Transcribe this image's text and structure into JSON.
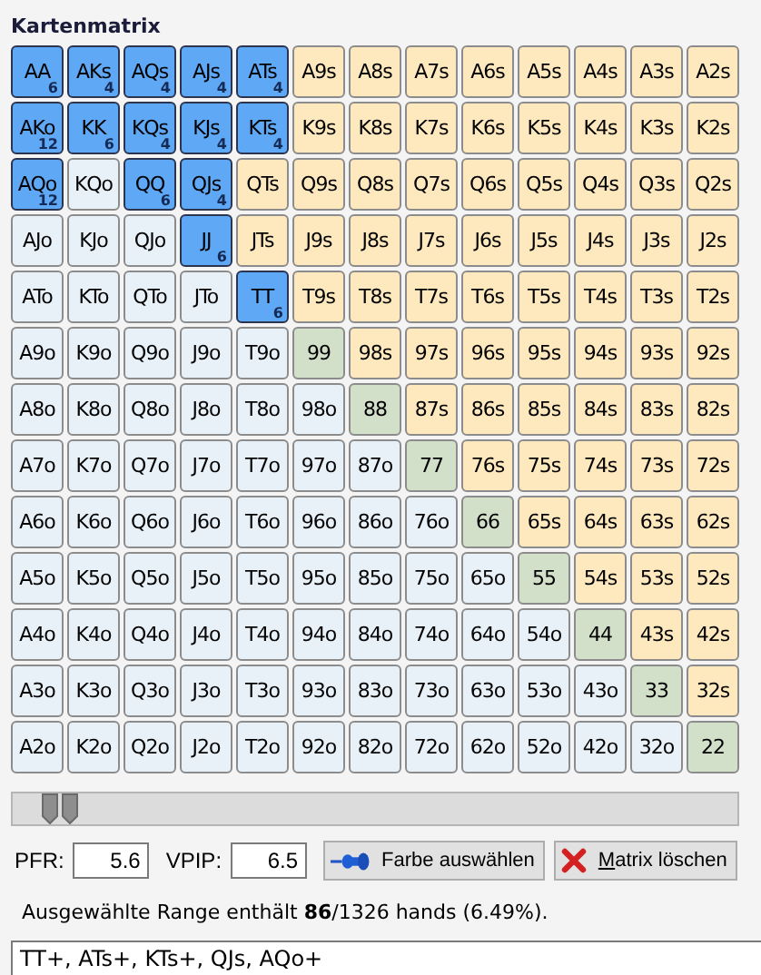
{
  "matrix": {
    "title": "Kartenmatrix",
    "rows": [
      [
        {
          "label": "AA",
          "kind": "pair",
          "selected": true,
          "count": "6"
        },
        {
          "label": "AKs",
          "kind": "suited",
          "selected": true,
          "count": "4"
        },
        {
          "label": "AQs",
          "kind": "suited",
          "selected": true,
          "count": "4"
        },
        {
          "label": "AJs",
          "kind": "suited",
          "selected": true,
          "count": "4"
        },
        {
          "label": "ATs",
          "kind": "suited",
          "selected": true,
          "count": "4"
        },
        {
          "label": "A9s",
          "kind": "suited",
          "selected": false
        },
        {
          "label": "A8s",
          "kind": "suited",
          "selected": false
        },
        {
          "label": "A7s",
          "kind": "suited",
          "selected": false
        },
        {
          "label": "A6s",
          "kind": "suited",
          "selected": false
        },
        {
          "label": "A5s",
          "kind": "suited",
          "selected": false
        },
        {
          "label": "A4s",
          "kind": "suited",
          "selected": false
        },
        {
          "label": "A3s",
          "kind": "suited",
          "selected": false
        },
        {
          "label": "A2s",
          "kind": "suited",
          "selected": false
        }
      ],
      [
        {
          "label": "AKo",
          "kind": "offsuit",
          "selected": true,
          "count": "12"
        },
        {
          "label": "KK",
          "kind": "pair",
          "selected": true,
          "count": "6"
        },
        {
          "label": "KQs",
          "kind": "suited",
          "selected": true,
          "count": "4"
        },
        {
          "label": "KJs",
          "kind": "suited",
          "selected": true,
          "count": "4"
        },
        {
          "label": "KTs",
          "kind": "suited",
          "selected": true,
          "count": "4"
        },
        {
          "label": "K9s",
          "kind": "suited",
          "selected": false
        },
        {
          "label": "K8s",
          "kind": "suited",
          "selected": false
        },
        {
          "label": "K7s",
          "kind": "suited",
          "selected": false
        },
        {
          "label": "K6s",
          "kind": "suited",
          "selected": false
        },
        {
          "label": "K5s",
          "kind": "suited",
          "selected": false
        },
        {
          "label": "K4s",
          "kind": "suited",
          "selected": false
        },
        {
          "label": "K3s",
          "kind": "suited",
          "selected": false
        },
        {
          "label": "K2s",
          "kind": "suited",
          "selected": false
        }
      ],
      [
        {
          "label": "AQo",
          "kind": "offsuit",
          "selected": true,
          "count": "12"
        },
        {
          "label": "KQo",
          "kind": "offsuit",
          "selected": false
        },
        {
          "label": "QQ",
          "kind": "pair",
          "selected": true,
          "count": "6"
        },
        {
          "label": "QJs",
          "kind": "suited",
          "selected": true,
          "count": "4"
        },
        {
          "label": "QTs",
          "kind": "suited",
          "selected": false
        },
        {
          "label": "Q9s",
          "kind": "suited",
          "selected": false
        },
        {
          "label": "Q8s",
          "kind": "suited",
          "selected": false
        },
        {
          "label": "Q7s",
          "kind": "suited",
          "selected": false
        },
        {
          "label": "Q6s",
          "kind": "suited",
          "selected": false
        },
        {
          "label": "Q5s",
          "kind": "suited",
          "selected": false
        },
        {
          "label": "Q4s",
          "kind": "suited",
          "selected": false
        },
        {
          "label": "Q3s",
          "kind": "suited",
          "selected": false
        },
        {
          "label": "Q2s",
          "kind": "suited",
          "selected": false
        }
      ],
      [
        {
          "label": "AJo",
          "kind": "offsuit",
          "selected": false
        },
        {
          "label": "KJo",
          "kind": "offsuit",
          "selected": false
        },
        {
          "label": "QJo",
          "kind": "offsuit",
          "selected": false
        },
        {
          "label": "JJ",
          "kind": "pair",
          "selected": true,
          "count": "6"
        },
        {
          "label": "JTs",
          "kind": "suited",
          "selected": false
        },
        {
          "label": "J9s",
          "kind": "suited",
          "selected": false
        },
        {
          "label": "J8s",
          "kind": "suited",
          "selected": false
        },
        {
          "label": "J7s",
          "kind": "suited",
          "selected": false
        },
        {
          "label": "J6s",
          "kind": "suited",
          "selected": false
        },
        {
          "label": "J5s",
          "kind": "suited",
          "selected": false
        },
        {
          "label": "J4s",
          "kind": "suited",
          "selected": false
        },
        {
          "label": "J3s",
          "kind": "suited",
          "selected": false
        },
        {
          "label": "J2s",
          "kind": "suited",
          "selected": false
        }
      ],
      [
        {
          "label": "ATo",
          "kind": "offsuit",
          "selected": false
        },
        {
          "label": "KTo",
          "kind": "offsuit",
          "selected": false
        },
        {
          "label": "QTo",
          "kind": "offsuit",
          "selected": false
        },
        {
          "label": "JTo",
          "kind": "offsuit",
          "selected": false
        },
        {
          "label": "TT",
          "kind": "pair",
          "selected": true,
          "count": "6"
        },
        {
          "label": "T9s",
          "kind": "suited",
          "selected": false
        },
        {
          "label": "T8s",
          "kind": "suited",
          "selected": false
        },
        {
          "label": "T7s",
          "kind": "suited",
          "selected": false
        },
        {
          "label": "T6s",
          "kind": "suited",
          "selected": false
        },
        {
          "label": "T5s",
          "kind": "suited",
          "selected": false
        },
        {
          "label": "T4s",
          "kind": "suited",
          "selected": false
        },
        {
          "label": "T3s",
          "kind": "suited",
          "selected": false
        },
        {
          "label": "T2s",
          "kind": "suited",
          "selected": false
        }
      ],
      [
        {
          "label": "A9o",
          "kind": "offsuit",
          "selected": false
        },
        {
          "label": "K9o",
          "kind": "offsuit",
          "selected": false
        },
        {
          "label": "Q9o",
          "kind": "offsuit",
          "selected": false
        },
        {
          "label": "J9o",
          "kind": "offsuit",
          "selected": false
        },
        {
          "label": "T9o",
          "kind": "offsuit",
          "selected": false
        },
        {
          "label": "99",
          "kind": "pair",
          "selected": false
        },
        {
          "label": "98s",
          "kind": "suited",
          "selected": false
        },
        {
          "label": "97s",
          "kind": "suited",
          "selected": false
        },
        {
          "label": "96s",
          "kind": "suited",
          "selected": false
        },
        {
          "label": "95s",
          "kind": "suited",
          "selected": false
        },
        {
          "label": "94s",
          "kind": "suited",
          "selected": false
        },
        {
          "label": "93s",
          "kind": "suited",
          "selected": false
        },
        {
          "label": "92s",
          "kind": "suited",
          "selected": false
        }
      ],
      [
        {
          "label": "A8o",
          "kind": "offsuit",
          "selected": false
        },
        {
          "label": "K8o",
          "kind": "offsuit",
          "selected": false
        },
        {
          "label": "Q8o",
          "kind": "offsuit",
          "selected": false
        },
        {
          "label": "J8o",
          "kind": "offsuit",
          "selected": false
        },
        {
          "label": "T8o",
          "kind": "offsuit",
          "selected": false
        },
        {
          "label": "98o",
          "kind": "offsuit",
          "selected": false
        },
        {
          "label": "88",
          "kind": "pair",
          "selected": false
        },
        {
          "label": "87s",
          "kind": "suited",
          "selected": false
        },
        {
          "label": "86s",
          "kind": "suited",
          "selected": false
        },
        {
          "label": "85s",
          "kind": "suited",
          "selected": false
        },
        {
          "label": "84s",
          "kind": "suited",
          "selected": false
        },
        {
          "label": "83s",
          "kind": "suited",
          "selected": false
        },
        {
          "label": "82s",
          "kind": "suited",
          "selected": false
        }
      ],
      [
        {
          "label": "A7o",
          "kind": "offsuit",
          "selected": false
        },
        {
          "label": "K7o",
          "kind": "offsuit",
          "selected": false
        },
        {
          "label": "Q7o",
          "kind": "offsuit",
          "selected": false
        },
        {
          "label": "J7o",
          "kind": "offsuit",
          "selected": false
        },
        {
          "label": "T7o",
          "kind": "offsuit",
          "selected": false
        },
        {
          "label": "97o",
          "kind": "offsuit",
          "selected": false
        },
        {
          "label": "87o",
          "kind": "offsuit",
          "selected": false
        },
        {
          "label": "77",
          "kind": "pair",
          "selected": false
        },
        {
          "label": "76s",
          "kind": "suited",
          "selected": false
        },
        {
          "label": "75s",
          "kind": "suited",
          "selected": false
        },
        {
          "label": "74s",
          "kind": "suited",
          "selected": false
        },
        {
          "label": "73s",
          "kind": "suited",
          "selected": false
        },
        {
          "label": "72s",
          "kind": "suited",
          "selected": false
        }
      ],
      [
        {
          "label": "A6o",
          "kind": "offsuit",
          "selected": false
        },
        {
          "label": "K6o",
          "kind": "offsuit",
          "selected": false
        },
        {
          "label": "Q6o",
          "kind": "offsuit",
          "selected": false
        },
        {
          "label": "J6o",
          "kind": "offsuit",
          "selected": false
        },
        {
          "label": "T6o",
          "kind": "offsuit",
          "selected": false
        },
        {
          "label": "96o",
          "kind": "offsuit",
          "selected": false
        },
        {
          "label": "86o",
          "kind": "offsuit",
          "selected": false
        },
        {
          "label": "76o",
          "kind": "offsuit",
          "selected": false
        },
        {
          "label": "66",
          "kind": "pair",
          "selected": false
        },
        {
          "label": "65s",
          "kind": "suited",
          "selected": false
        },
        {
          "label": "64s",
          "kind": "suited",
          "selected": false
        },
        {
          "label": "63s",
          "kind": "suited",
          "selected": false
        },
        {
          "label": "62s",
          "kind": "suited",
          "selected": false
        }
      ],
      [
        {
          "label": "A5o",
          "kind": "offsuit",
          "selected": false
        },
        {
          "label": "K5o",
          "kind": "offsuit",
          "selected": false
        },
        {
          "label": "Q5o",
          "kind": "offsuit",
          "selected": false
        },
        {
          "label": "J5o",
          "kind": "offsuit",
          "selected": false
        },
        {
          "label": "T5o",
          "kind": "offsuit",
          "selected": false
        },
        {
          "label": "95o",
          "kind": "offsuit",
          "selected": false
        },
        {
          "label": "85o",
          "kind": "offsuit",
          "selected": false
        },
        {
          "label": "75o",
          "kind": "offsuit",
          "selected": false
        },
        {
          "label": "65o",
          "kind": "offsuit",
          "selected": false
        },
        {
          "label": "55",
          "kind": "pair",
          "selected": false
        },
        {
          "label": "54s",
          "kind": "suited",
          "selected": false
        },
        {
          "label": "53s",
          "kind": "suited",
          "selected": false
        },
        {
          "label": "52s",
          "kind": "suited",
          "selected": false
        }
      ],
      [
        {
          "label": "A4o",
          "kind": "offsuit",
          "selected": false
        },
        {
          "label": "K4o",
          "kind": "offsuit",
          "selected": false
        },
        {
          "label": "Q4o",
          "kind": "offsuit",
          "selected": false
        },
        {
          "label": "J4o",
          "kind": "offsuit",
          "selected": false
        },
        {
          "label": "T4o",
          "kind": "offsuit",
          "selected": false
        },
        {
          "label": "94o",
          "kind": "offsuit",
          "selected": false
        },
        {
          "label": "84o",
          "kind": "offsuit",
          "selected": false
        },
        {
          "label": "74o",
          "kind": "offsuit",
          "selected": false
        },
        {
          "label": "64o",
          "kind": "offsuit",
          "selected": false
        },
        {
          "label": "54o",
          "kind": "offsuit",
          "selected": false
        },
        {
          "label": "44",
          "kind": "pair",
          "selected": false
        },
        {
          "label": "43s",
          "kind": "suited",
          "selected": false
        },
        {
          "label": "42s",
          "kind": "suited",
          "selected": false
        }
      ],
      [
        {
          "label": "A3o",
          "kind": "offsuit",
          "selected": false
        },
        {
          "label": "K3o",
          "kind": "offsuit",
          "selected": false
        },
        {
          "label": "Q3o",
          "kind": "offsuit",
          "selected": false
        },
        {
          "label": "J3o",
          "kind": "offsuit",
          "selected": false
        },
        {
          "label": "T3o",
          "kind": "offsuit",
          "selected": false
        },
        {
          "label": "93o",
          "kind": "offsuit",
          "selected": false
        },
        {
          "label": "83o",
          "kind": "offsuit",
          "selected": false
        },
        {
          "label": "73o",
          "kind": "offsuit",
          "selected": false
        },
        {
          "label": "63o",
          "kind": "offsuit",
          "selected": false
        },
        {
          "label": "53o",
          "kind": "offsuit",
          "selected": false
        },
        {
          "label": "43o",
          "kind": "offsuit",
          "selected": false
        },
        {
          "label": "33",
          "kind": "pair",
          "selected": false
        },
        {
          "label": "32s",
          "kind": "suited",
          "selected": false
        }
      ],
      [
        {
          "label": "A2o",
          "kind": "offsuit",
          "selected": false
        },
        {
          "label": "K2o",
          "kind": "offsuit",
          "selected": false
        },
        {
          "label": "Q2o",
          "kind": "offsuit",
          "selected": false
        },
        {
          "label": "J2o",
          "kind": "offsuit",
          "selected": false
        },
        {
          "label": "T2o",
          "kind": "offsuit",
          "selected": false
        },
        {
          "label": "92o",
          "kind": "offsuit",
          "selected": false
        },
        {
          "label": "82o",
          "kind": "offsuit",
          "selected": false
        },
        {
          "label": "72o",
          "kind": "offsuit",
          "selected": false
        },
        {
          "label": "62o",
          "kind": "offsuit",
          "selected": false
        },
        {
          "label": "52o",
          "kind": "offsuit",
          "selected": false
        },
        {
          "label": "42o",
          "kind": "offsuit",
          "selected": false
        },
        {
          "label": "32o",
          "kind": "offsuit",
          "selected": false
        },
        {
          "label": "22",
          "kind": "pair",
          "selected": false
        }
      ]
    ]
  },
  "slider": {
    "level": 0.065
  },
  "fields": [
    {
      "label": "PFR:",
      "value": "5.6"
    },
    {
      "label": "VPIP:",
      "value": "6.5"
    }
  ],
  "buttons": [
    {
      "label": "Farbe auswählen",
      "kind": "color"
    },
    {
      "label": "Matrix löschen",
      "kind": "clear"
    }
  ],
  "summary": "Ausgewählte Range enthält **86**/1326 hands (6.49%).",
  "range_text": "TT+, ATs+, KTs+, QJs, AQo+"
}
